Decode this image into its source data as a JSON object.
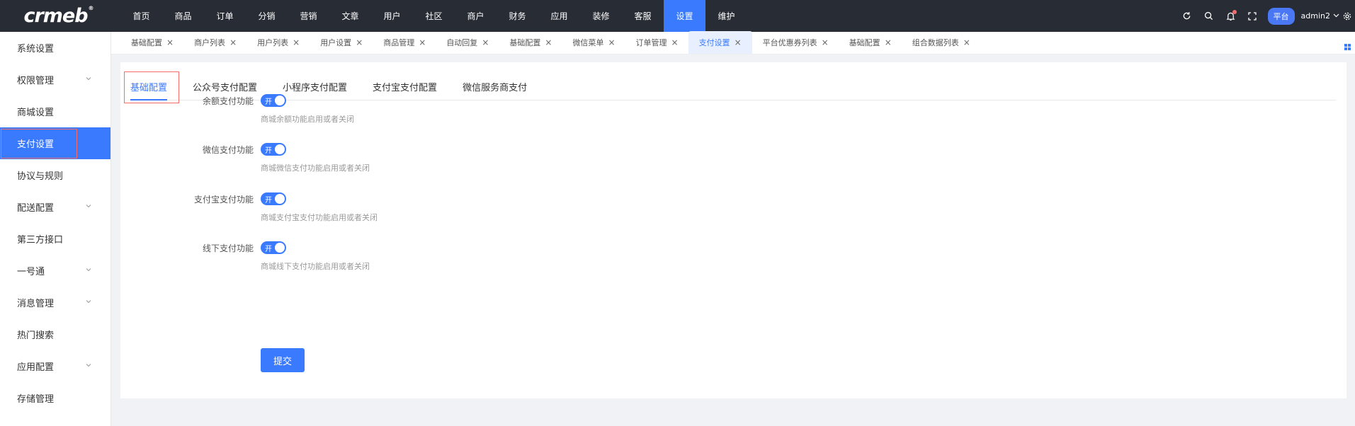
{
  "logo": {
    "text": "crmeb",
    "reg": "®"
  },
  "topnav": [
    "首页",
    "商品",
    "订单",
    "分销",
    "营销",
    "文章",
    "用户",
    "社区",
    "商户",
    "财务",
    "应用",
    "装修",
    "客服",
    "设置",
    "维护"
  ],
  "topnav_active": "设置",
  "top_right": {
    "platform": "平台",
    "user": "admin2"
  },
  "sidebar": [
    "系统设置",
    "权限管理",
    "商城设置",
    "支付设置",
    "协议与规则",
    "配送配置",
    "第三方接口",
    "一号通",
    "消息管理",
    "热门搜索",
    "应用配置",
    "存储管理"
  ],
  "sidebar_expandable": [
    "权限管理",
    "配送配置",
    "一号通",
    "消息管理",
    "应用配置"
  ],
  "sidebar_active": "支付设置",
  "tabs": [
    "基础配置",
    "商户列表",
    "用户列表",
    "用户设置",
    "商品管理",
    "自动回复",
    "基础配置",
    "微信菜单",
    "订单管理",
    "支付设置",
    "平台优惠券列表",
    "基础配置",
    "组合数据列表"
  ],
  "tabs_active_index": 9,
  "inner_tabs": [
    "基础配置",
    "公众号支付配置",
    "小程序支付配置",
    "支付宝支付配置",
    "微信服务商支付"
  ],
  "form": [
    {
      "label": "余额支付功能",
      "switch": "开",
      "help": "商城余额功能启用或者关闭"
    },
    {
      "label": "微信支付功能",
      "switch": "开",
      "help": "商城微信支付功能启用或者关闭"
    },
    {
      "label": "支付宝支付功能",
      "switch": "开",
      "help": "商城支付宝支付功能启用或者关闭"
    },
    {
      "label": "线下支付功能",
      "switch": "开",
      "help": "商城线下支付功能启用或者关闭"
    }
  ],
  "submit_label": "提交",
  "colors": {
    "accent": "#3a7afe",
    "topbar": "#282c34",
    "highlight": "#f56c6c"
  }
}
